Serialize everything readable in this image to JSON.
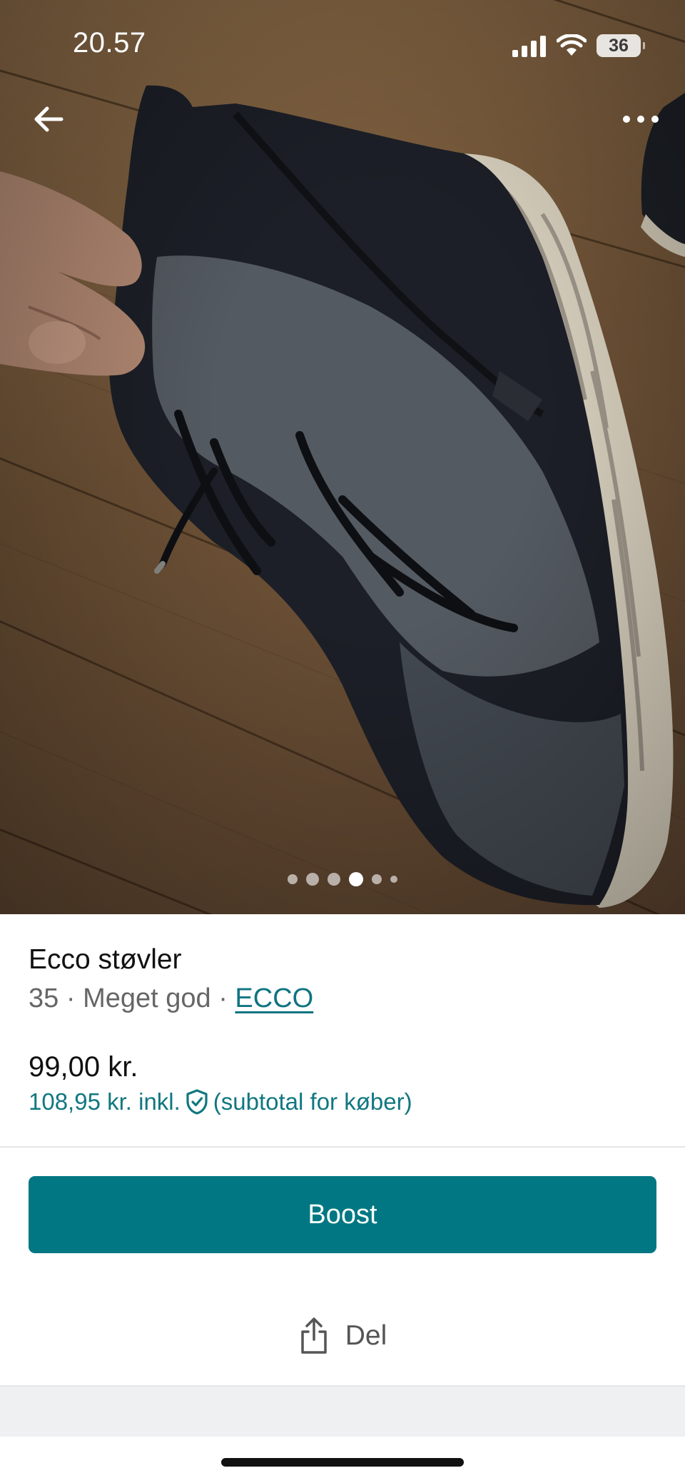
{
  "status_bar": {
    "time": "20.57",
    "battery": "36",
    "signal_icon": "cellular-signal-icon",
    "wifi_icon": "wifi-icon"
  },
  "photo": {
    "description_icon": "product-photo",
    "carousel": {
      "total": 6,
      "active_index": 3
    }
  },
  "nav": {
    "back_icon": "arrow-left-icon",
    "more_icon": "more-horizontal-icon"
  },
  "listing": {
    "title": "Ecco støvler",
    "size": "35",
    "separator": " · ",
    "condition": "Meget god",
    "brand": "ECCO",
    "price": "99,00 kr.",
    "price_incl": "108,95 kr. inkl.",
    "price_incl_note": "(subtotal for køber)",
    "buyer_protection_icon": "shield-check-icon"
  },
  "actions": {
    "boost_label": "Boost",
    "share_label": "Del",
    "share_icon": "share-icon"
  },
  "colors": {
    "accent": "#007782",
    "accent_text": "#117780"
  }
}
